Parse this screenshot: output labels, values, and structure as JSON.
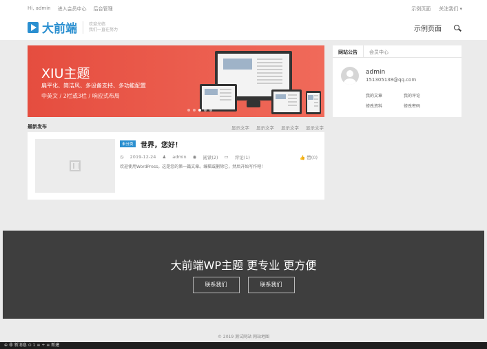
{
  "topbar": {
    "greeting": "Hi, admin",
    "member_center": "进入会员中心",
    "admin": "后台管理",
    "example_page": "示例页面",
    "follow_us": "关注我们 ▾"
  },
  "logo": {
    "name": "大前端",
    "slogan_line1": "欢迎光临",
    "slogan_line2": "我们一直在努力"
  },
  "nav": {
    "example_page": "示例页面"
  },
  "banner": {
    "title": "XIU主题",
    "line1": "扁平化、简洁风、多设备支持、多功能配置",
    "line2": "中英文 / 2栏或3栏 / 响应式布局",
    "dots": 5,
    "active_dot": 3
  },
  "widget": {
    "tabs": [
      "网站公告",
      "会员中心"
    ],
    "active_tab": 0,
    "username": "admin",
    "email": "151305138@qq.com",
    "links": [
      "我的文章",
      "我的评论",
      "修改资料",
      "修改密码"
    ]
  },
  "latest": {
    "title": "最新发布",
    "links": [
      "显示文字",
      "显示文字",
      "显示文字",
      "显示文字"
    ]
  },
  "post": {
    "category": "未分类",
    "title": "世界，您好！",
    "date": "2019-12-24",
    "author": "admin",
    "views": "阅读(2)",
    "comments": "评论(1)",
    "praise": "赞(0)",
    "excerpt": "欢迎使用WordPress。这是您的第一篇文章。编辑或删除它，然后开始写作吧！"
  },
  "cta": {
    "title": "大前端WP主题 更专业 更方便",
    "buttons": [
      "联系我们",
      "联系我们"
    ]
  },
  "footer": {
    "copyright": "© 2019 测试网站  网站地图"
  },
  "taskbar": {
    "text": "⊕ 非 新消息 ⊙ 1 ≡ + ≡ 新建"
  }
}
